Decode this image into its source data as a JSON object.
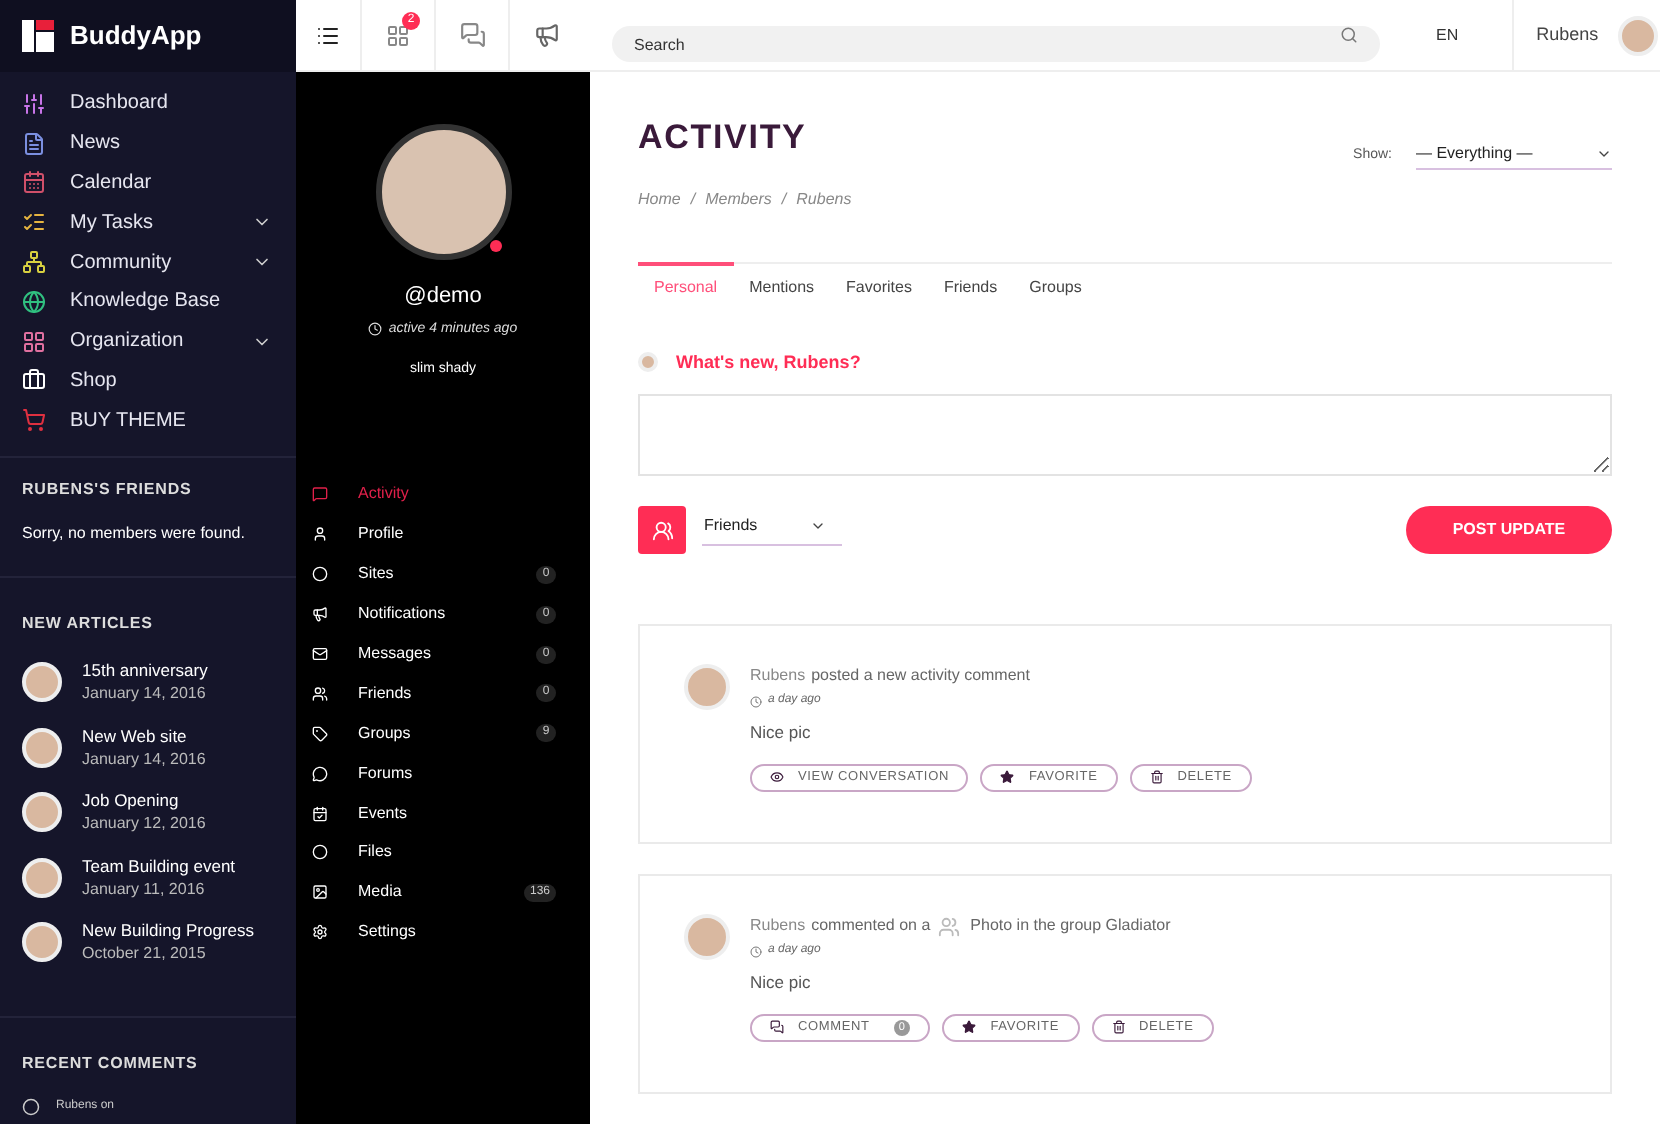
{
  "brand": {
    "name": "BuddyApp"
  },
  "nav": [
    {
      "label": "Dashboard",
      "expandable": false
    },
    {
      "label": "News",
      "expandable": false
    },
    {
      "label": "Calendar",
      "expandable": false
    },
    {
      "label": "My Tasks",
      "expandable": true
    },
    {
      "label": "Community",
      "expandable": true
    },
    {
      "label": "Knowledge Base",
      "expandable": false
    },
    {
      "label": "Organization",
      "expandable": true
    },
    {
      "label": "Shop",
      "expandable": false
    },
    {
      "label": "BUY THEME",
      "expandable": false
    }
  ],
  "friends": {
    "title": "RUBENS'S FRIENDS",
    "empty": "Sorry, no members were found."
  },
  "articles": {
    "title": "NEW ARTICLES",
    "items": [
      {
        "title": "15th anniversary",
        "date": "January 14, 2016"
      },
      {
        "title": "New Web site",
        "date": "January 14, 2016"
      },
      {
        "title": "Job Opening",
        "date": "January 12, 2016"
      },
      {
        "title": "Team Building event",
        "date": "January 11, 2016"
      },
      {
        "title": "New Building Progress",
        "date": "October 21, 2015"
      }
    ]
  },
  "recent_comments": {
    "title": "RECENT COMMENTS",
    "first": "Rubens on"
  },
  "toolbar": {
    "notification_count": "2"
  },
  "profile": {
    "handle": "@demo",
    "active": "active 4 minutes ago",
    "name": "slim shady",
    "online": true
  },
  "profile_menu": [
    {
      "label": "Activity",
      "selected": true
    },
    {
      "label": "Profile",
      "selected": false
    },
    {
      "label": "Sites",
      "count": "0",
      "selected": false
    },
    {
      "label": "Notifications",
      "count": "0",
      "selected": false
    },
    {
      "label": "Messages",
      "count": "0",
      "selected": false
    },
    {
      "label": "Friends",
      "count": "0",
      "selected": false
    },
    {
      "label": "Groups",
      "count": "9",
      "selected": false
    },
    {
      "label": "Forums",
      "selected": false
    },
    {
      "label": "Events",
      "selected": false
    },
    {
      "label": "Files",
      "selected": false
    },
    {
      "label": "Media",
      "count": "136",
      "selected": false
    },
    {
      "label": "Settings",
      "selected": false
    }
  ],
  "topbar": {
    "search_placeholder": "Search",
    "language": "EN",
    "user": "Rubens"
  },
  "page": {
    "title": "ACTIVITY",
    "breadcrumb": [
      "Home",
      "Members",
      "Rubens"
    ],
    "breadcrumb_separator": "/",
    "show_label": "Show:",
    "show_value": "— Everything —"
  },
  "tabs": [
    {
      "label": "Personal",
      "selected": true
    },
    {
      "label": "Mentions",
      "selected": false
    },
    {
      "label": "Favorites",
      "selected": false
    },
    {
      "label": "Friends",
      "selected": false
    },
    {
      "label": "Groups",
      "selected": false
    }
  ],
  "composer": {
    "prompt": "What's new, Rubens?",
    "visibility": "Friends",
    "submit": "POST UPDATE"
  },
  "posts": [
    {
      "kind": "update",
      "author": "Rubens",
      "action": "posted a new activity comment",
      "time": "a day ago",
      "text": "Nice pic",
      "buttons": [
        {
          "kind": "view",
          "label": "VIEW CONVERSATION"
        },
        {
          "kind": "favorite",
          "label": "FAVORITE"
        },
        {
          "kind": "delete",
          "label": "DELETE"
        }
      ]
    },
    {
      "kind": "group",
      "author": "Rubens",
      "action": "commented on a",
      "object": "Photo in the group Gladiator",
      "time": "a day ago",
      "text": "Nice pic",
      "buttons": [
        {
          "kind": "comment",
          "label": "COMMENT",
          "count": "0"
        },
        {
          "kind": "favorite",
          "label": "FAVORITE"
        },
        {
          "kind": "delete",
          "label": "DELETE"
        }
      ]
    }
  ]
}
